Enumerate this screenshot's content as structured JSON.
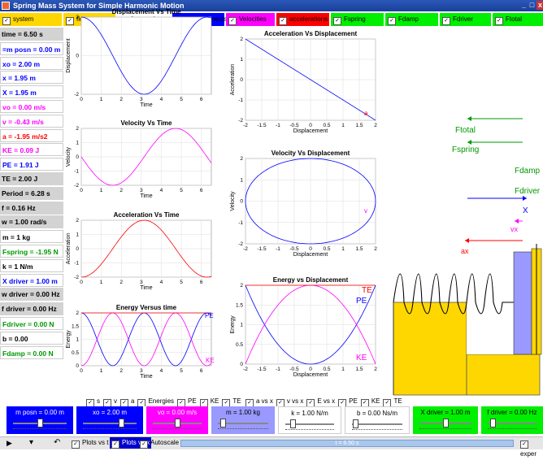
{
  "window": {
    "title": "Spring Mass System for Simple Harmonic Motion",
    "controls": [
      "_",
      "□",
      "x"
    ]
  },
  "toggles": [
    {
      "label": "system",
      "bg": "#ffd700",
      "checked": true
    },
    {
      "label": "floors",
      "bg": "#ffd700",
      "checked": true
    },
    {
      "label": "Autoscale",
      "bg": "#ffffff",
      "checked": true
    },
    {
      "label": "displacements",
      "bg": "#0000ff",
      "checked": true
    },
    {
      "label": "Velocities",
      "bg": "#ff00ff",
      "checked": true
    },
    {
      "label": "accelerations",
      "bg": "#ff0000",
      "checked": true
    },
    {
      "label": "Fspring",
      "bg": "#00ee00",
      "checked": true
    },
    {
      "label": "Fdamp",
      "bg": "#00ee00",
      "checked": true
    },
    {
      "label": "Fdriver",
      "bg": "#00ee00",
      "checked": true
    },
    {
      "label": "Ftotal",
      "bg": "#00ee00",
      "checked": true
    }
  ],
  "variables": [
    {
      "text": "time = 6.50 s",
      "style": "g"
    },
    {
      "text": "=m posn = 0.00 m",
      "style": "b"
    },
    {
      "text": "xo = 2.00 m",
      "style": "b"
    },
    {
      "text": "x = 1.95 m",
      "style": "b"
    },
    {
      "text": "X = 1.95 m",
      "style": "b"
    },
    {
      "text": "vo = 0.00 m/s",
      "style": "m"
    },
    {
      "text": "v = -0.43 m/s",
      "style": "m"
    },
    {
      "text": "a = -1.95 m/s2",
      "style": "r"
    },
    {
      "text": "KE = 0.09 J",
      "style": "m"
    },
    {
      "text": "PE = 1.91 J",
      "style": "b"
    },
    {
      "text": "TE = 2.00 J",
      "style": "g"
    },
    {
      "text": "Period = 6.28 s",
      "style": "g"
    },
    {
      "text": "f = 0.16 Hz",
      "style": "g"
    },
    {
      "text": "w = 1.00 rad/s",
      "style": "g"
    },
    {
      "text": "m = 1 kg",
      "style": "w"
    },
    {
      "text": "Fspring = -1.95 N",
      "style": "gr"
    },
    {
      "text": "k = 1 N/m",
      "style": "w"
    },
    {
      "text": "X driver = 1.00 m",
      "style": "b"
    },
    {
      "text": "w driver = 0.00 Hz",
      "style": "g"
    },
    {
      "text": "f driver = 0.00 Hz",
      "style": "g"
    },
    {
      "text": "Fdriver = 0.00 N",
      "style": "gr"
    },
    {
      "text": "b = 0.00",
      "style": "w"
    },
    {
      "text": "Fdamp = 0.00 N",
      "style": "gr"
    }
  ],
  "colors": {
    "displacement": "#0000ff",
    "velocity": "#ff00ff",
    "acceleration": "#ff0000",
    "pe": "#0000ff",
    "ke": "#ff00ff",
    "te": "#ff0000",
    "force": "#009900",
    "mass": "#9999ff",
    "floor": "#ffd700"
  },
  "chart_data": [
    {
      "type": "line",
      "title": "Displacement Vs Time",
      "xlabel": "Time",
      "ylabel": "Displacement",
      "xlim": [
        0,
        6.5
      ],
      "ylim": [
        -2,
        2
      ],
      "xticks": [
        0,
        1,
        2,
        3,
        4,
        5,
        6
      ],
      "yticks": [
        -2,
        0,
        2
      ],
      "series": [
        {
          "fn": "2cos(t)",
          "color": "#0000ff"
        }
      ]
    },
    {
      "type": "line",
      "title": "Velocity Vs Time",
      "xlabel": "Time",
      "ylabel": "Velocity",
      "xlim": [
        0,
        6.5
      ],
      "ylim": [
        -2,
        2
      ],
      "xticks": [
        0,
        1,
        2,
        3,
        4,
        5,
        6
      ],
      "yticks": [
        -2,
        -1,
        0,
        1,
        2
      ],
      "series": [
        {
          "fn": "-2sin(t)",
          "color": "#ff00ff"
        }
      ]
    },
    {
      "type": "line",
      "title": "Acceleration Vs Time",
      "xlabel": "Time",
      "ylabel": "Acceleration",
      "xlim": [
        0,
        6.5
      ],
      "ylim": [
        -2,
        2
      ],
      "xticks": [
        0,
        1,
        2,
        3,
        4,
        5,
        6
      ],
      "yticks": [
        -2,
        -1,
        0,
        1,
        2
      ],
      "series": [
        {
          "fn": "-2cos(t)",
          "color": "#ff0000"
        }
      ]
    },
    {
      "type": "line",
      "title": "Energy Versus time",
      "xlabel": "Time",
      "ylabel": "Energy",
      "xlim": [
        0,
        6.5
      ],
      "ylim": [
        0,
        2
      ],
      "xticks": [
        0,
        1,
        2,
        3,
        4,
        5,
        6
      ],
      "yticks": [
        0,
        0.5,
        1.0,
        1.5,
        2.0
      ],
      "series": [
        {
          "name": "PE",
          "fn": "2cos^2(t)",
          "color": "#0000ff"
        },
        {
          "name": "KE",
          "fn": "2sin^2(t)",
          "color": "#ff00ff"
        },
        {
          "name": "TE",
          "fn": "2",
          "color": "#ff0000"
        }
      ]
    },
    {
      "type": "line",
      "title": "Acceleration Vs Displacement",
      "xlabel": "Displacement",
      "ylabel": "Acceleration",
      "xlim": [
        -2,
        2
      ],
      "ylim": [
        -2,
        2
      ],
      "xticks": [
        -2.0,
        -1.5,
        -1.0,
        -0.5,
        0,
        0.5,
        1.0,
        1.5,
        2.0
      ],
      "yticks": [
        -2,
        -1,
        0,
        1,
        2
      ],
      "series": [
        {
          "name": "a",
          "fn": "-x",
          "color": "#0000ff"
        }
      ]
    },
    {
      "type": "line",
      "title": "Velocity Vs Displacement",
      "xlabel": "Displacement",
      "ylabel": "Velocity",
      "xlim": [
        -2,
        2
      ],
      "ylim": [
        -2,
        2
      ],
      "xticks": [
        -2.0,
        -1.5,
        -1.0,
        -0.5,
        0,
        0.5,
        1.0,
        1.5,
        2.0
      ],
      "yticks": [
        -2,
        -1,
        0,
        1,
        2
      ],
      "series": [
        {
          "name": "v",
          "fn": "ellipse",
          "color": "#0000ff"
        }
      ]
    },
    {
      "type": "line",
      "title": "Energy vs Displacement",
      "xlabel": "Displacement",
      "ylabel": "Energy",
      "xlim": [
        -2,
        2
      ],
      "ylim": [
        0,
        2
      ],
      "xticks": [
        -2.0,
        -1.5,
        -1.0,
        -0.5,
        0,
        0.5,
        1.0,
        1.5,
        2.0
      ],
      "yticks": [
        0,
        0.5,
        1.0,
        1.5,
        2.0
      ],
      "series": [
        {
          "name": "PE",
          "fn": "x^2/2",
          "color": "#0000ff"
        },
        {
          "name": "KE",
          "fn": "2-x^2/2",
          "color": "#ff00ff"
        },
        {
          "name": "TE",
          "fn": "2",
          "color": "#ff0000"
        }
      ]
    }
  ],
  "forces": [
    {
      "label": "Ftotal",
      "color": "#009900"
    },
    {
      "label": "Fspring",
      "color": "#009900"
    },
    {
      "label": "Fdamp",
      "color": "#009900"
    },
    {
      "label": "Fdriver",
      "color": "#009900"
    },
    {
      "label": "X",
      "color": "#0000ff"
    },
    {
      "label": "vx",
      "color": "#ff00ff"
    },
    {
      "label": "ax",
      "color": "#ff0000"
    }
  ],
  "checkrows": {
    "left": [
      {
        "label": "s",
        "checked": true
      },
      {
        "label": "v",
        "checked": true
      },
      {
        "label": "a",
        "checked": true
      },
      {
        "label": "Energies",
        "checked": true
      },
      {
        "label": "PE",
        "checked": true
      },
      {
        "label": "KE",
        "checked": true
      },
      {
        "label": "TE",
        "checked": true
      }
    ],
    "right": [
      {
        "label": "a vs x",
        "checked": true
      },
      {
        "label": "v vs x",
        "checked": true
      },
      {
        "label": "E vs x",
        "checked": true
      },
      {
        "label": "PE",
        "checked": true
      },
      {
        "label": "KE",
        "checked": true
      },
      {
        "label": "TE",
        "checked": true
      }
    ]
  },
  "sliders": [
    {
      "label": "m posn = 0.00 m",
      "bg": "#0000ff",
      "fg": "#ffffff",
      "value": 0.5
    },
    {
      "label": "xo = 2.00 m",
      "bg": "#0000ff",
      "fg": "#ffffff",
      "value": 0.75
    },
    {
      "label": "vo = 0.00 m/s",
      "bg": "#ff00ff",
      "fg": "#ffffff",
      "value": 0.5
    },
    {
      "label": "m = 1.00 kg",
      "bg": "#9999ff",
      "fg": "#000000",
      "value": 0.05
    },
    {
      "label": "k = 1.00 N/m",
      "bg": "#ffffff",
      "fg": "#000000",
      "value": 0.1
    },
    {
      "label": "b = 0.00 Ns/m",
      "bg": "#ffffff",
      "fg": "#000000",
      "value": 0.02
    },
    {
      "label": "X driver = 1.00 m",
      "bg": "#00ee00",
      "fg": "#000000",
      "value": 0.5
    },
    {
      "label": "f driver = 0.00 Hz",
      "bg": "#00ee00",
      "fg": "#000000",
      "value": 0.05
    }
  ],
  "bottombar": {
    "play": "▶",
    "step": "▾",
    "reset": "↶",
    "plots_label": "Plots vs t",
    "plots_vs_x": "Plots vs x",
    "autoscale": "Autoscale",
    "timeline": "t = 6.50 s",
    "expert": "exper"
  }
}
